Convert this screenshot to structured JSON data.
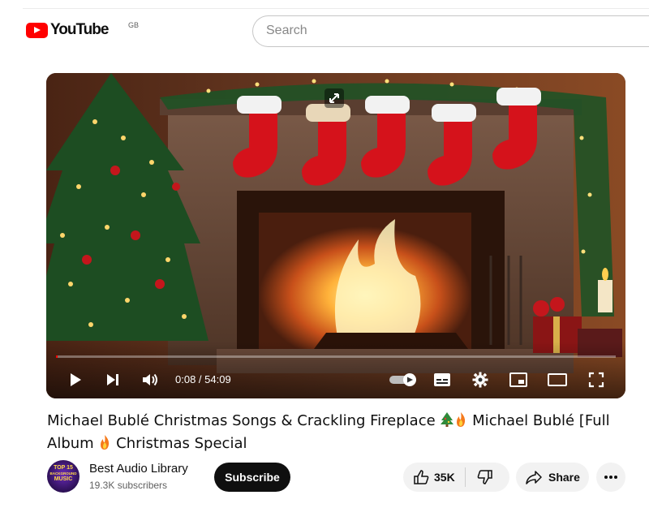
{
  "header": {
    "logo_text": "YouTube",
    "country_code": "GB",
    "search_placeholder": "Search"
  },
  "player": {
    "current_time": "0:08",
    "duration": "54:09",
    "time_display": "0:08 / 54:09",
    "progress_fraction": 0.0025
  },
  "video": {
    "title_part1": "Michael Bublé Christmas Songs & Crackling Fireplace",
    "title_part2": "Michael Bublé [Full Album",
    "title_part3": "Christmas Special"
  },
  "channel": {
    "name": "Best Audio Library",
    "subscribers": "19.3K subscribers",
    "avatar_line1": "TOP 15",
    "avatar_line2": "BACKGROUND",
    "avatar_line3": "MUSIC"
  },
  "actions": {
    "subscribe_label": "Subscribe",
    "like_count": "35K",
    "share_label": "Share"
  },
  "icons": {
    "play": "play-icon",
    "next": "next-icon",
    "volume": "volume-icon",
    "autoplay": "autoplay-toggle-icon",
    "captions": "captions-icon",
    "settings": "gear-icon",
    "miniplayer": "miniplayer-icon",
    "theater": "theater-mode-icon",
    "fullscreen": "fullscreen-icon",
    "like": "thumbs-up-icon",
    "dislike": "thumbs-down-icon",
    "share": "share-arrow-icon",
    "more": "more-horizontal-icon"
  },
  "colors": {
    "brand_red": "#ff0000",
    "text_primary": "#0f0f0f",
    "text_secondary": "#606060",
    "pill_bg": "#f2f2f2"
  }
}
